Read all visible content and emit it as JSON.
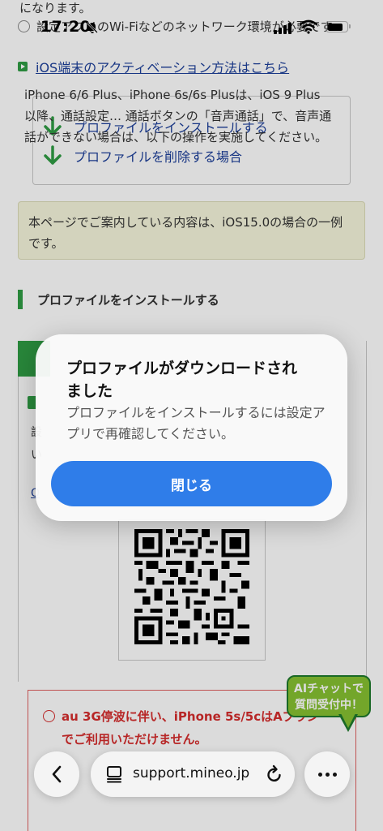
{
  "status_bar": {
    "time": "17:20"
  },
  "background": {
    "top_text": "になります。",
    "top_bullet": "設定アプリのWi-Fiなどのネットワーク環境が必要です",
    "ios_link": "iOS端末のアクティベーション方法はこちら",
    "toc": [
      "プロファイルをインストールする",
      "プロファイルを削除する場合"
    ],
    "note": "本ページでご案内している内容は、iOS15.0の場合の一例です。",
    "section_heading": "プロファイルをインストールする",
    "fragment_1": "設",
    "fragment_2": "い",
    "fragment_3": "O",
    "warning_title": "au 3G停波に伴い、iPhone 5s/5cはAプラン",
    "warning_title_2": "でご利用いただけません。",
    "warning_body": "iPhone 6/6 Plus、iPhone 6s/6s Plusは、iOS 9 Plus以降、通話設定… 通話ボタンの「音声通話」で、音声通話ができない場合は、以下の操作を実施してください。",
    "ai_badge_line1": "AIチャットで",
    "ai_badge_line2": "質問受付中！"
  },
  "alert": {
    "title": "プロファイルがダウンロードされました",
    "message": "プロファイルをインストールするには設定アプリで再確認してください。",
    "close_button": "閉じる"
  },
  "toolbar": {
    "url": "support.mineo.jp"
  }
}
